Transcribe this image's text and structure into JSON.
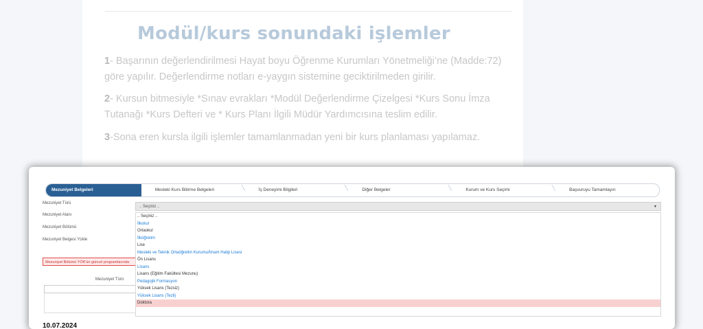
{
  "article": {
    "title": "Modül/kurs sonundaki işlemler",
    "items": [
      {
        "num": "1",
        "text": "- Başarının değerlendirilmesi Hayat boyu Öğrenme Kurumları Yönetmeliği’ne (Madde:72) göre yapılır. Değerlendirme notları e-yaygın sistemine geciktirilmeden girilir."
      },
      {
        "num": "2",
        "text": "- Kursun bitmesiyle *Sınav evrakları *Modül Değerlendirme Çizelgesi *Kurs Sonu İmza Tutanağı *Kurs Defteri ve * Kurs Planı İlgili Müdür Yardımcısına teslim edilir."
      },
      {
        "num": "3",
        "text": "-Sona eren kursla ilgili işlemler tamamlanmadan yeni bir kurs planlaması yapılamaz."
      }
    ]
  },
  "wizard": {
    "steps": [
      "Mezuniyet Belgeleri",
      "Mesleki Kurs Bitirme Belgeleri",
      "İş Deneyimi Bilgileri",
      "Diğer Belgeler",
      "Kurum ve Kurs Seçimi",
      "Başvuruyu Tamamlayın"
    ],
    "active_step": 0
  },
  "form": {
    "labels": {
      "mezuniyet_turu": "Mezuniyet Türü",
      "mezuniyet_alani": "Mezuniyet Alanı",
      "mezuniyet_bolumu": "Mezuniyet Bölümü",
      "belge_yukle": "Mezuniyet Belgesi Yükle"
    },
    "warning": "Mezuniyet Bölümü YÖK'ün güncel programlarında",
    "table_header": "Mezuniyet Türü",
    "select_value": ".. Seçiniz ..",
    "options": [
      {
        "label": ".. Seçiniz ..",
        "style": "plain"
      },
      {
        "label": "İlkokul",
        "style": "link"
      },
      {
        "label": "Ortaokul",
        "style": "plain"
      },
      {
        "label": "İlköğretim",
        "style": "link"
      },
      {
        "label": "Lise",
        "style": "plain"
      },
      {
        "label": "Mesleki ve Teknik Ortaöğretim Kurumu/İmam Hatip Lisesi",
        "style": "link"
      },
      {
        "label": "Ön Lisans",
        "style": "plain"
      },
      {
        "label": "Lisans",
        "style": "link"
      },
      {
        "label": "Lisans (Eğitim Fakültesi Mezunu)",
        "style": "plain"
      },
      {
        "label": "Pedagojik Formasyon",
        "style": "link"
      },
      {
        "label": "Yüksek Lisans (Tezsiz)",
        "style": "plain"
      },
      {
        "label": "Yüksek Lisans (Tezli)",
        "style": "link"
      },
      {
        "label": "Doktora",
        "style": "highlighted"
      }
    ]
  },
  "date": "10.07.2024",
  "colors": {
    "active_step": "#2a5f94",
    "link": "#1a7bd6",
    "highlight": "#f8d0d0",
    "warning_border": "#e04a4a"
  }
}
